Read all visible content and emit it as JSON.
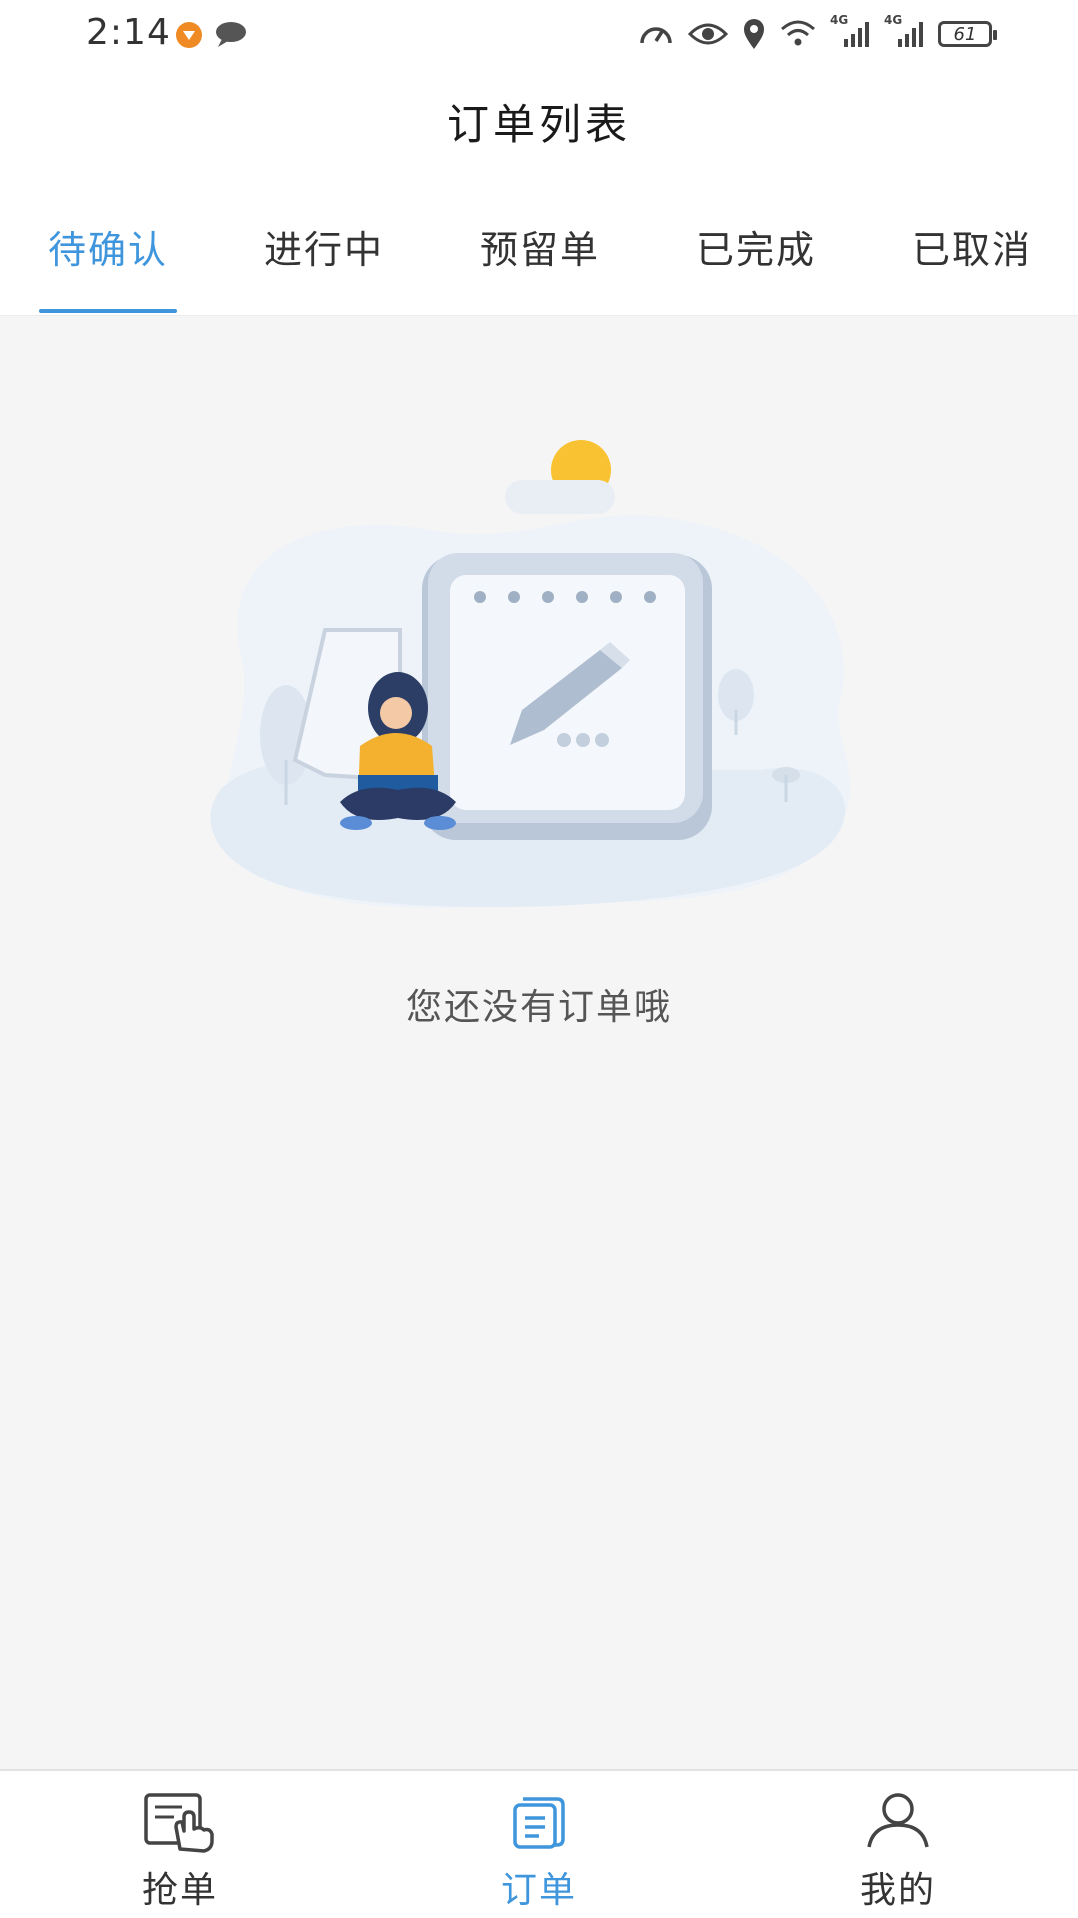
{
  "status_bar": {
    "time": "2:14",
    "signal_labels": [
      "4G",
      "4G"
    ],
    "battery_level": "61",
    "icons": [
      "notification-badge-icon",
      "message-bubble-icon",
      "speedometer-icon",
      "eye-icon",
      "location-pin-icon",
      "wifi-icon",
      "signal-icon",
      "signal-icon",
      "battery-icon"
    ]
  },
  "header": {
    "title": "订单列表"
  },
  "tabs": [
    {
      "label": "待确认",
      "active": true
    },
    {
      "label": "进行中",
      "active": false
    },
    {
      "label": "预留单",
      "active": false
    },
    {
      "label": "已完成",
      "active": false
    },
    {
      "label": "已取消",
      "active": false
    }
  ],
  "empty_state": {
    "message": "您还没有订单哦"
  },
  "bottom_nav": [
    {
      "label": "抢单",
      "icon": "grab-order-hand-icon",
      "active": false
    },
    {
      "label": "订单",
      "icon": "order-list-icon",
      "active": true
    },
    {
      "label": "我的",
      "icon": "user-profile-icon",
      "active": false
    }
  ],
  "colors": {
    "accent": "#3f96dd",
    "background": "#f5f5f5",
    "text": "#333333"
  }
}
